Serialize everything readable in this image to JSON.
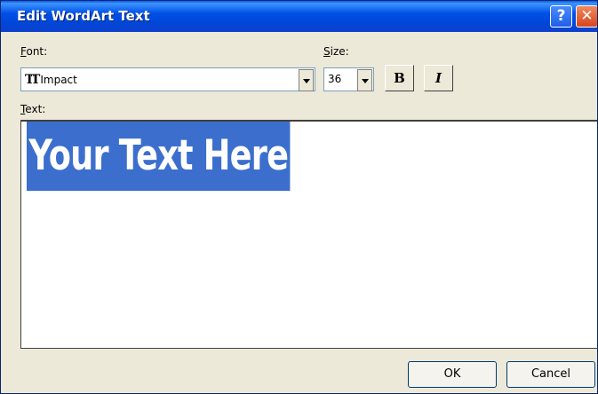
{
  "window": {
    "title": "Edit WordArt Text",
    "help_glyph": "?",
    "close_glyph": "✕"
  },
  "font": {
    "label_accel": "F",
    "label_rest": "ont:",
    "value": "Impact",
    "icon": "truetype-font-icon"
  },
  "size": {
    "label_accel": "S",
    "label_rest": "ize:",
    "value": "36"
  },
  "format": {
    "bold_label": "B",
    "italic_label": "I"
  },
  "text": {
    "label_accel": "T",
    "label_rest": "ext:",
    "value": "Your Text Here",
    "selection_color": "#3c6fcd"
  },
  "buttons": {
    "ok": "OK",
    "cancel": "Cancel"
  },
  "colors": {
    "titlebar": "#0050e6",
    "dialog_bg": "#ece9d8",
    "close_button": "#d8441c"
  }
}
